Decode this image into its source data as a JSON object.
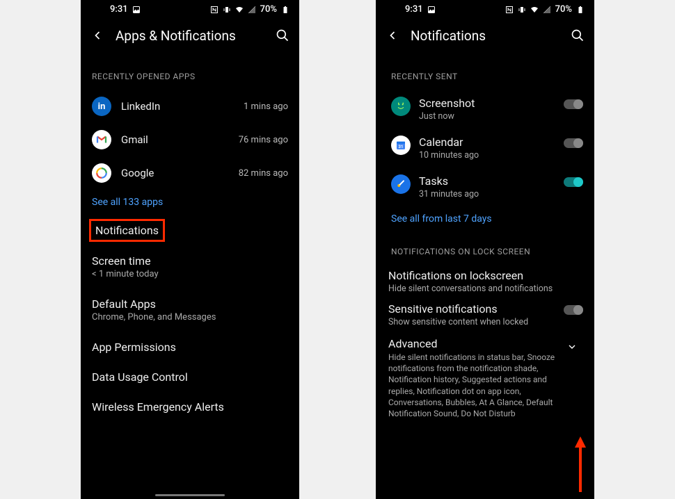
{
  "status": {
    "time": "9:31",
    "battery": "70%"
  },
  "left": {
    "title": "Apps & Notifications",
    "section_recent": "RECENTLY OPENED APPS",
    "apps": [
      {
        "name": "LinkedIn",
        "time": "1 mins ago"
      },
      {
        "name": "Gmail",
        "time": "76 mins ago"
      },
      {
        "name": "Google",
        "time": "82 mins ago"
      }
    ],
    "see_all": "See all 133 apps",
    "items": [
      {
        "title": "Notifications",
        "sub": ""
      },
      {
        "title": "Screen time",
        "sub": "< 1 minute today"
      },
      {
        "title": "Default Apps",
        "sub": "Chrome, Phone, and Messages"
      },
      {
        "title": "App Permissions",
        "sub": ""
      },
      {
        "title": "Data Usage Control",
        "sub": ""
      },
      {
        "title": "Wireless Emergency Alerts",
        "sub": ""
      }
    ]
  },
  "right": {
    "title": "Notifications",
    "section_recent": "RECENTLY SENT",
    "recent": [
      {
        "name": "Screenshot",
        "time": "Just now",
        "on": false
      },
      {
        "name": "Calendar",
        "time": "10 minutes ago",
        "on": false
      },
      {
        "name": "Tasks",
        "time": "31 minutes ago",
        "on": true
      }
    ],
    "see_all": "See all from last 7 days",
    "section_lock": "NOTIFICATIONS ON LOCK SCREEN",
    "lockscreen": {
      "title": "Notifications on lockscreen",
      "sub": "Hide silent conversations and notifications"
    },
    "sensitive": {
      "title": "Sensitive notifications",
      "sub": "Show sensitive content when locked"
    },
    "advanced": {
      "title": "Advanced",
      "sub": "Hide silent notifications in status bar, Snooze notifications from the notification shade, Notification history, Suggested actions and replies, Notification dot on app icon, Conversations, Bubbles, At A Glance, Default Notification Sound, Do Not Disturb"
    }
  }
}
